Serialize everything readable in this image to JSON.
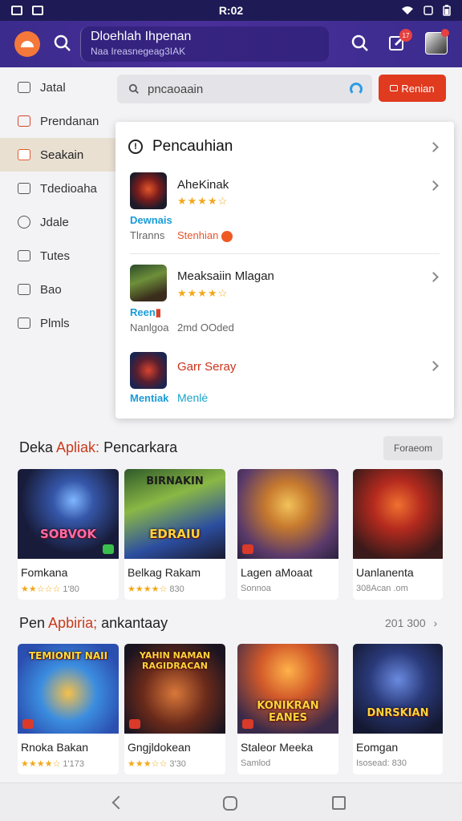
{
  "status": {
    "time": "R:02"
  },
  "header": {
    "title": "Dloehlah Ihpenan",
    "subtitle": "Naa Ireasnegeag3IAK",
    "notification_count": "17"
  },
  "sidebar": {
    "items": [
      {
        "label": "Jatal"
      },
      {
        "label": "Prendanan"
      },
      {
        "label": "Seakain"
      },
      {
        "label": "Tdedioaha"
      },
      {
        "label": "Jdale"
      },
      {
        "label": "Tutes"
      },
      {
        "label": "Bao"
      },
      {
        "label": "Plmls"
      }
    ]
  },
  "search": {
    "value": "pncaoaain",
    "button_label": "Renian"
  },
  "panel": {
    "title": "Pencauhian",
    "results": [
      {
        "name": "AheKinak",
        "stars": "★★★★☆",
        "line1": "Dewnais",
        "line2": "Tlranns",
        "extra": "Stenhian"
      },
      {
        "name": "Meaksaiin Mlagan",
        "stars": "★★★★☆",
        "line1": "Reen",
        "line2": "Nanlgoa",
        "extra": "2md OOded"
      },
      {
        "name": "Garr Seray",
        "stars": "",
        "line1": "Mentiak",
        "line2": "",
        "extra": "Menlė"
      }
    ]
  },
  "section1": {
    "title_a": "Deka ",
    "title_b": "Apliak:",
    "title_c": " Pencarkara",
    "button_label": "Foraeom",
    "cards": [
      {
        "art": "SOBVOK",
        "name": "Fomkana",
        "stars": "★★☆☆☆",
        "meta": " 1'80"
      },
      {
        "art": "EDRAIU",
        "art_top": "BIRNAKIN",
        "name": "Belkag Rakam",
        "stars": "★★★★☆",
        "meta": " 830"
      },
      {
        "art": "",
        "name": "Lagen aMoaat",
        "stars": "",
        "meta": "Sonnoa"
      },
      {
        "art": "",
        "name": "Uanlanenta",
        "stars": "",
        "meta": "308Acan .om"
      }
    ]
  },
  "section2": {
    "title_a": "Pen ",
    "title_b": "Apbiria;",
    "title_c": " ankantaay",
    "more_label": "201 300",
    "cards": [
      {
        "art": "",
        "art_top": "TEMIONIT NAII",
        "name": "Rnoka Bakan",
        "stars": "★★★★☆",
        "meta": " 1'173"
      },
      {
        "art": "",
        "art_top": "YAHIN NAMAN RAGIDRACAN",
        "name": "Gngjldokean",
        "stars": "★★★☆☆",
        "meta": " 3'30"
      },
      {
        "art": "KONIKRAN EANES",
        "name": "Staleor Meeka",
        "stars": "",
        "meta": "Samlod"
      },
      {
        "art": "DNRSKIAN",
        "name": "Eomgan",
        "stars": "",
        "meta": "Isosead: 830"
      }
    ]
  },
  "colors": {
    "appbar": "#3a2b8c",
    "accent": "#e03a1f",
    "star": "#f2a81a",
    "link": "#1a9bd8"
  }
}
